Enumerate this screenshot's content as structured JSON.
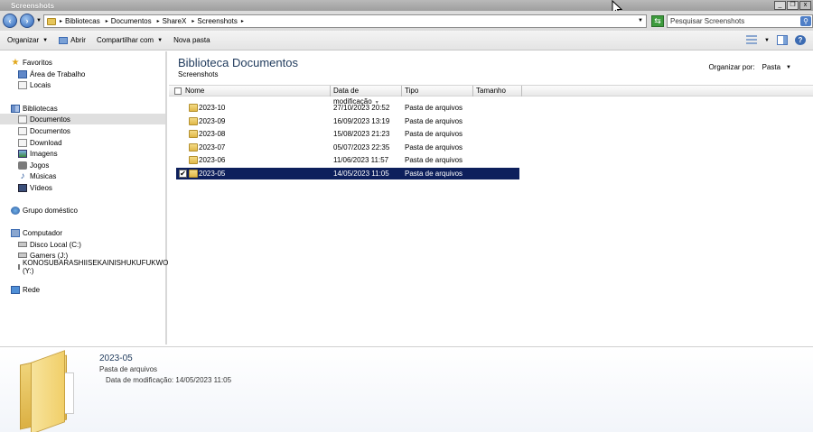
{
  "window": {
    "title": "Screenshots",
    "controls": [
      "_",
      "❐",
      "x"
    ]
  },
  "address": {
    "crumbs": [
      "Bibliotecas",
      "Documentos",
      "ShareX",
      "Screenshots"
    ],
    "search_placeholder": "Pesquisar Screenshots"
  },
  "toolbar": {
    "organize": "Organizar",
    "open": "Abrir",
    "share": "Compartilhar com",
    "new_folder": "Nova pasta"
  },
  "nav": {
    "favorites": "Favoritos",
    "desktop": "Área de Trabalho",
    "places": "Locais",
    "libraries": "Bibliotecas",
    "documents": "Documentos",
    "documents2": "Documentos",
    "download": "Download",
    "images": "Imagens",
    "games": "Jogos",
    "music": "Músicas",
    "videos": "Vídeos",
    "homegroup": "Grupo doméstico",
    "computer": "Computador",
    "drive_c": "Disco Local (C:)",
    "drive_j": "Gamers  (J:)",
    "drive_y": "KONOSUBARASHIISEKAINISHUKUFUKWO (Y:)",
    "network": "Rede"
  },
  "main": {
    "title": "Biblioteca Documentos",
    "subtitle": "Screenshots",
    "arrange_label": "Organizar por:",
    "arrange_value": "Pasta",
    "columns": [
      "Nome",
      "Data de modificação",
      "Tipo",
      "Tamanho"
    ],
    "rows": [
      {
        "name": "2023-10",
        "date": "27/10/2023 20:52",
        "type": "Pasta de arquivos"
      },
      {
        "name": "2023-09",
        "date": "16/09/2023 13:19",
        "type": "Pasta de arquivos"
      },
      {
        "name": "2023-08",
        "date": "15/08/2023 21:23",
        "type": "Pasta de arquivos"
      },
      {
        "name": "2023-07",
        "date": "05/07/2023 22:35",
        "type": "Pasta de arquivos"
      },
      {
        "name": "2023-06",
        "date": "11/06/2023 11:57",
        "type": "Pasta de arquivos"
      },
      {
        "name": "2023-05",
        "date": "14/05/2023 11:05",
        "type": "Pasta de arquivos"
      }
    ],
    "selected_row": 5
  },
  "details": {
    "name": "2023-05",
    "type": "Pasta de arquivos",
    "modified": "Data de modificação: 14/05/2023 11:05"
  }
}
